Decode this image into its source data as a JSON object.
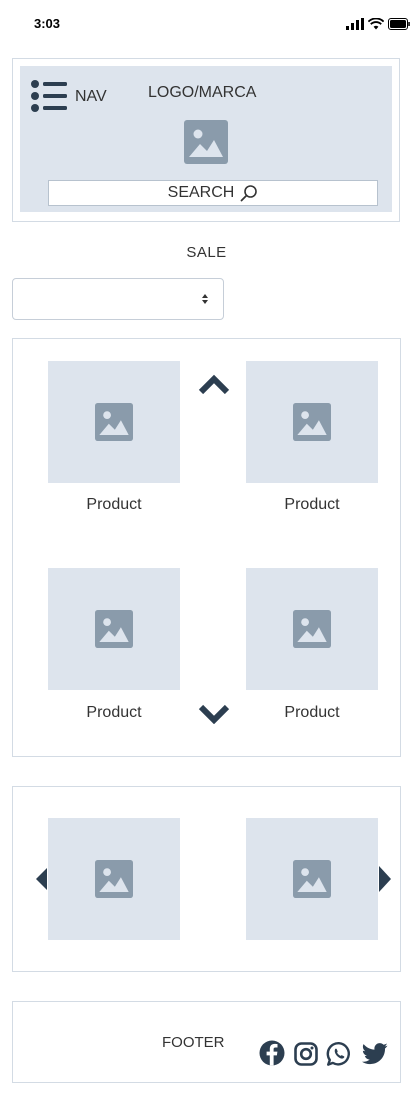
{
  "status_bar": {
    "time": "3:03"
  },
  "header": {
    "nav_label": "NAV",
    "logo_label": "LOGO/MARCA",
    "search_label": "SEARCH"
  },
  "sale": {
    "label": "SALE",
    "select_value": ""
  },
  "products": [
    {
      "label": "Product"
    },
    {
      "label": "Product"
    },
    {
      "label": "Product"
    },
    {
      "label": "Product"
    }
  ],
  "footer": {
    "label": "FOOTER",
    "social_icons": [
      "facebook-icon",
      "instagram-icon",
      "whatsapp-icon",
      "twitter-icon"
    ]
  },
  "colors": {
    "placeholder_bg": "#dde4ed",
    "placeholder_icon": "#8a9bab",
    "border": "#d3dbe4",
    "dark_icon": "#2c3e50",
    "text": "#333333"
  }
}
